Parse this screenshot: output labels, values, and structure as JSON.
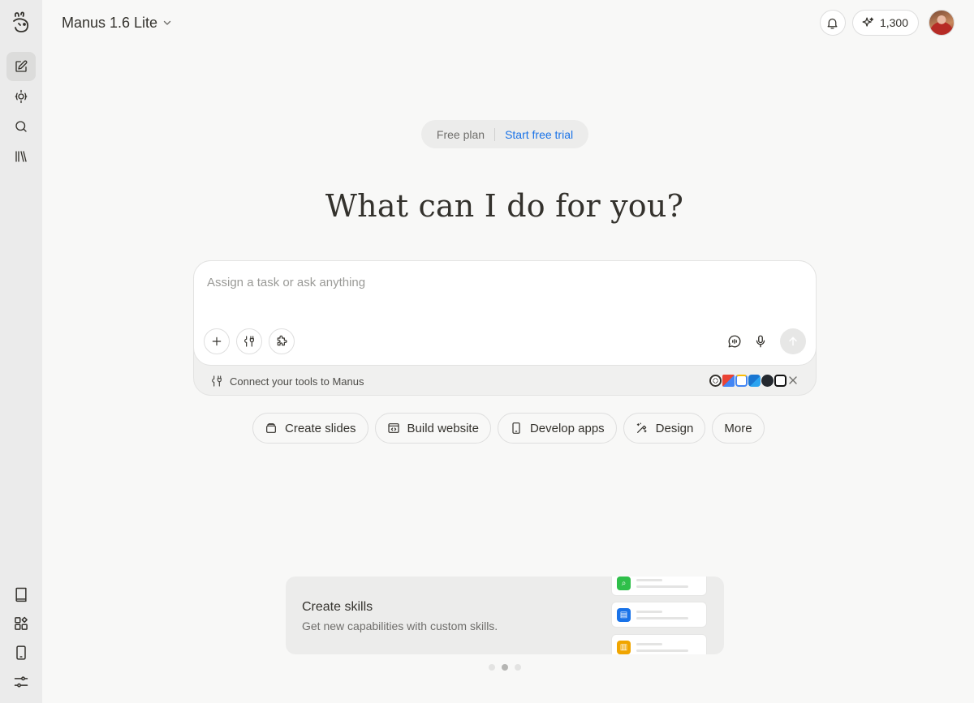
{
  "header": {
    "model_name": "Manus 1.6 Lite",
    "credits": "1,300"
  },
  "sidebar": {
    "top_items": [
      {
        "name": "new-task",
        "icon": "pencil-square-icon"
      },
      {
        "name": "agents",
        "icon": "agent-icon"
      },
      {
        "name": "search",
        "icon": "search-icon"
      },
      {
        "name": "library",
        "icon": "library-icon"
      }
    ],
    "bottom_items": [
      {
        "name": "docs",
        "icon": "book-icon"
      },
      {
        "name": "apps",
        "icon": "grid-icon"
      },
      {
        "name": "mobile",
        "icon": "phone-icon"
      },
      {
        "name": "settings",
        "icon": "sliders-icon"
      }
    ]
  },
  "plan": {
    "label": "Free plan",
    "cta": "Start free trial"
  },
  "hero": {
    "title": "What can I do for you?"
  },
  "composer": {
    "placeholder": "Assign a task or ask anything",
    "connect_text": "Connect your tools to Manus"
  },
  "chips": [
    {
      "label": "Create slides",
      "icon": "slides-icon"
    },
    {
      "label": "Build website",
      "icon": "website-icon"
    },
    {
      "label": "Develop apps",
      "icon": "phone-icon"
    },
    {
      "label": "Design",
      "icon": "design-icon"
    },
    {
      "label": "More",
      "icon": ""
    }
  ],
  "promo": {
    "title": "Create skills",
    "subtitle": "Get new capabilities with custom skills."
  },
  "carousel": {
    "total": 3,
    "active": 2
  },
  "colors": {
    "accent": "#1a73e8",
    "sidebar_bg": "#ebebeb",
    "page_bg": "#f8f8f7"
  }
}
